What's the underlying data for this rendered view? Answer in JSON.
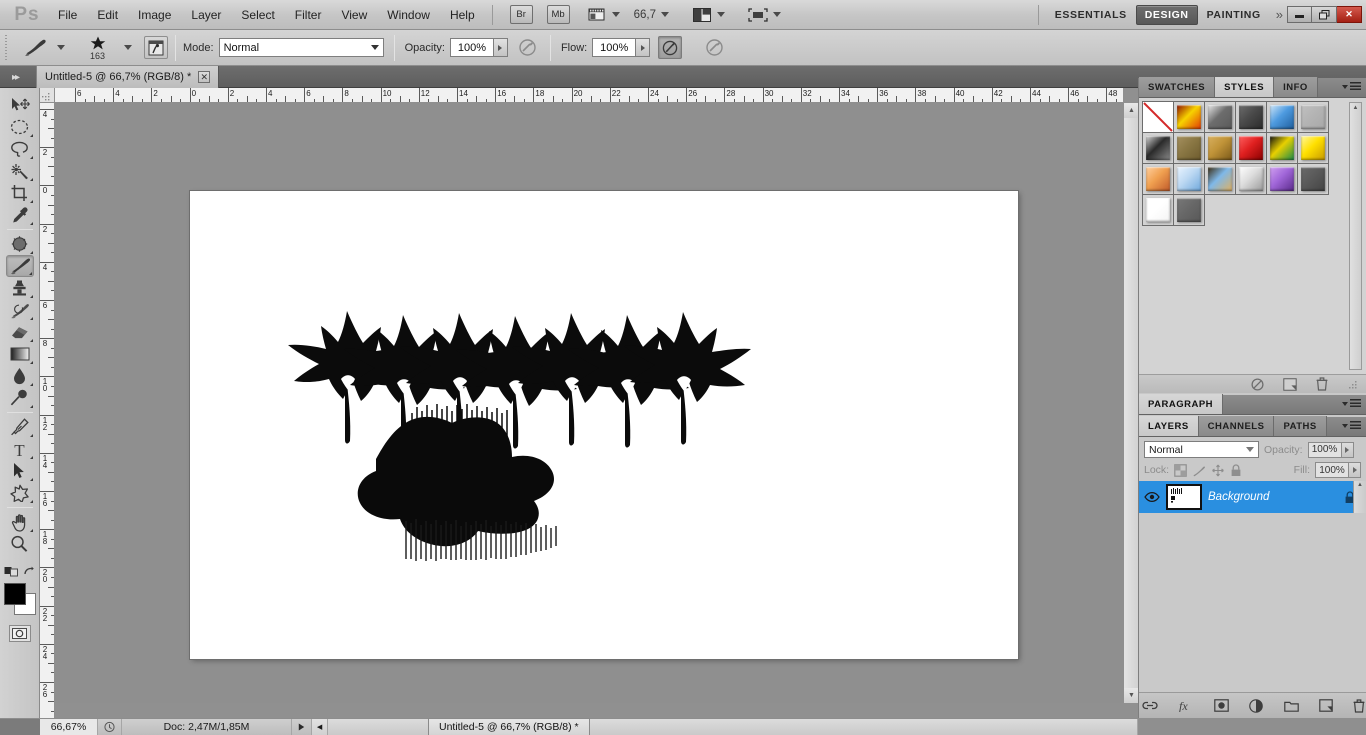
{
  "app": {
    "name": "Ps",
    "logo_label": "Ps"
  },
  "menubar": {
    "items": [
      "File",
      "Edit",
      "Image",
      "Layer",
      "Select",
      "Filter",
      "View",
      "Window",
      "Help"
    ],
    "bridge_label": "Br",
    "minibridge_label": "Mb",
    "zoom_value": "66,7",
    "screen_mode_icon": "screen-mode-icon",
    "arrange_icon": "arrange-documents-icon",
    "extras_icon": "view-extras-icon"
  },
  "workspaces": {
    "tabs": [
      "ESSENTIALS",
      "DESIGN",
      "PAINTING"
    ],
    "active": "DESIGN",
    "overflow_label": "»"
  },
  "window_controls": {
    "minimize": "–",
    "restore": "❐",
    "close": "✕"
  },
  "options_bar": {
    "brush_preset_icon": "brush-preset-icon",
    "brush_size": "163",
    "brush_panel_icon": "toggle-brush-panel-icon",
    "mode_label": "Mode:",
    "mode_value": "Normal",
    "opacity_label": "Opacity:",
    "opacity_value": "100%",
    "opacity_pressure_icon": "tablet-pressure-opacity-icon",
    "flow_label": "Flow:",
    "flow_value": "100%",
    "airbrush_icon": "airbrush-icon",
    "flow_pressure_icon": "tablet-pressure-size-icon"
  },
  "document_tab": {
    "title": "Untitled-5 @ 66,7% (RGB/8) *",
    "close_icon": "close-icon",
    "collapse_icon": "collapse-panel-icon"
  },
  "toolbox": {
    "tools": [
      {
        "name": "move-tool",
        "selected": false,
        "flyout": false
      },
      {
        "name": "elliptical-marquee-tool",
        "selected": false,
        "flyout": true
      },
      {
        "name": "lasso-tool",
        "selected": false,
        "flyout": true
      },
      {
        "name": "quick-selection-tool",
        "selected": false,
        "flyout": true
      },
      {
        "name": "crop-tool",
        "selected": false,
        "flyout": true
      },
      {
        "name": "eyedropper-tool",
        "selected": false,
        "flyout": true
      },
      {
        "name": "spot-healing-brush-tool",
        "selected": false,
        "flyout": true
      },
      {
        "name": "brush-tool",
        "selected": true,
        "flyout": true
      },
      {
        "name": "clone-stamp-tool",
        "selected": false,
        "flyout": true
      },
      {
        "name": "history-brush-tool",
        "selected": false,
        "flyout": true
      },
      {
        "name": "eraser-tool",
        "selected": false,
        "flyout": true
      },
      {
        "name": "gradient-tool",
        "selected": false,
        "flyout": true
      },
      {
        "name": "blur-tool",
        "selected": false,
        "flyout": true
      },
      {
        "name": "dodge-tool",
        "selected": false,
        "flyout": true
      },
      {
        "name": "pen-tool",
        "selected": false,
        "flyout": true
      },
      {
        "name": "horizontal-type-tool",
        "selected": false,
        "flyout": true
      },
      {
        "name": "path-selection-tool",
        "selected": false,
        "flyout": true
      },
      {
        "name": "custom-shape-tool",
        "selected": false,
        "flyout": true
      },
      {
        "name": "hand-tool",
        "selected": false,
        "flyout": true
      },
      {
        "name": "zoom-tool",
        "selected": false,
        "flyout": false
      }
    ],
    "foreground_color": "#000000",
    "background_color": "#ffffff",
    "quickmask_icon": "quick-mask-icon",
    "default-colors-icon": "default-colors-icon",
    "swap-colors-icon": "swap-colors-icon"
  },
  "rulers": {
    "unit": "cm",
    "horizontal_labels": [
      "6",
      "4",
      "2",
      "0",
      "2",
      "4",
      "6",
      "8",
      "10",
      "12",
      "14",
      "16",
      "18",
      "20",
      "22",
      "24",
      "26",
      "28",
      "30",
      "32",
      "34",
      "36",
      "38",
      "40",
      "42",
      "44",
      "46",
      "48"
    ],
    "vertical_labels": [
      "4",
      "2",
      "0",
      "2",
      "4",
      "6",
      "8",
      "10",
      "12",
      "14",
      "16",
      "18",
      "20",
      "22",
      "24",
      "26"
    ]
  },
  "canvas": {
    "background": "#ffffff",
    "artwork": [
      {
        "name": "maple-leaf-brush-stroke-row",
        "color": "#0a0a0a",
        "count": 7
      },
      {
        "name": "dense-leaf-scribble-blob",
        "color": "#0a0a0a"
      }
    ]
  },
  "panels": {
    "top_group": {
      "tabs": [
        "SWATCHES",
        "STYLES",
        "INFO"
      ],
      "active": "STYLES",
      "menu_icon": "panel-menu-icon",
      "styles": [
        {
          "name": "style-none",
          "kind": "none"
        },
        {
          "name": "style-sunset-sky",
          "c1": "#f7d200",
          "c2": "#e03a06",
          "c3": "#8e1100"
        },
        {
          "name": "style-bevel-gray",
          "c1": "#6d6d6d",
          "c2": "#5a5a5a",
          "c3": "#e8e8e8"
        },
        {
          "name": "style-dark-metal",
          "c1": "#4a4a4a",
          "c2": "#2b2b2b",
          "c3": "#6d6d6d"
        },
        {
          "name": "style-blue-glass",
          "c1": "#4e9be0",
          "c2": "#1f5f9e",
          "c3": "#cfe6f7"
        },
        {
          "name": "style-flat-gray",
          "c1": "#b4b4b4",
          "c2": "#a8a8a8",
          "c3": "#c0c0c0"
        },
        {
          "name": "style-gray-gradient",
          "c1": "#2a2a2a",
          "c2": "#8a8a8a",
          "c3": "#d8d8d8"
        },
        {
          "name": "style-olive-brown",
          "c1": "#8a7744",
          "c2": "#6e5c2e",
          "c3": "#a59060"
        },
        {
          "name": "style-golden-brown",
          "c1": "#c09338",
          "c2": "#7b5a1a",
          "c3": "#d8b060"
        },
        {
          "name": "style-red-stripes",
          "c1": "#e02020",
          "c2": "#8a0000",
          "c3": "#ff6060"
        },
        {
          "name": "style-rainbow-abstract",
          "c1": "#e8d000",
          "c2": "#1a8a4a",
          "c3": "#111111"
        },
        {
          "name": "style-yellow-glass",
          "c1": "#ffe000",
          "c2": "#c79a00",
          "c3": "#fff7a0"
        },
        {
          "name": "style-orange-sunset",
          "c1": "#f0a050",
          "c2": "#c05a2a",
          "c3": "#ffd0a0"
        },
        {
          "name": "style-light-blue-sky",
          "c1": "#bcd8f2",
          "c2": "#6fa8dc",
          "c3": "#eaf4ff"
        },
        {
          "name": "style-beach-horizon",
          "c1": "#7fb8e8",
          "c2": "#e0b060",
          "c3": "#3a2a10"
        },
        {
          "name": "style-noise-texture",
          "c1": "#dcdcdc",
          "c2": "#9a9a9a",
          "c3": "#ffffff"
        },
        {
          "name": "style-purple-shadow",
          "c1": "#a066d8",
          "c2": "#5a2a8a",
          "c3": "#d0a0f0"
        },
        {
          "name": "style-charcoal",
          "c1": "#5a5a5a",
          "c2": "#444444",
          "c3": "#6a6a6a"
        },
        {
          "name": "style-white-plain",
          "c1": "#ffffff",
          "c2": "#f4f4f4",
          "c3": "#ffffff"
        },
        {
          "name": "style-medium-gray",
          "c1": "#686868",
          "c2": "#585858",
          "c3": "#787878"
        }
      ],
      "footer_icons": [
        "clear-style-icon",
        "new-style-icon",
        "delete-style-icon",
        "resize-grip-icon"
      ]
    },
    "paragraph": {
      "tab": "PARAGRAPH",
      "menu_icon": "panel-menu-icon"
    },
    "layers_group": {
      "tabs": [
        "LAYERS",
        "CHANNELS",
        "PATHS"
      ],
      "active": "LAYERS",
      "menu_icon": "panel-menu-icon",
      "blend_mode": "Normal",
      "opacity_label": "Opacity:",
      "opacity_value": "100%",
      "lock_label": "Lock:",
      "lock_icons": [
        "lock-transparent-pixels-icon",
        "lock-image-pixels-icon",
        "lock-position-icon",
        "lock-all-icon"
      ],
      "fill_label": "Fill:",
      "fill_value": "100%",
      "layers": [
        {
          "name": "Background",
          "visible": true,
          "locked": true,
          "selected": true,
          "visibility_icon": "eye-icon",
          "lock_icon": "lock-icon"
        }
      ],
      "footer_icons": [
        "link-layers-icon",
        "layer-style-fx-icon",
        "add-layer-mask-icon",
        "new-adjustment-layer-icon",
        "new-group-icon",
        "new-layer-icon",
        "delete-layer-icon"
      ]
    }
  },
  "statusbar": {
    "zoom": "66,67%",
    "zoom_menu_icon": "zoom-menu-icon",
    "doc_info": "Doc: 2,47M/1,85M",
    "play_icon": "status-arrow-icon",
    "floating_tab": "Untitled-5 @ 66,7% (RGB/8) *"
  },
  "colors": {
    "accent_blue": "#2a8fe0",
    "chrome_light": "#d2d2d2",
    "chrome_mid": "#c2c2c2",
    "chrome_dark": "#6d6d6d",
    "canvas_bg": "#909090",
    "close_red": "#a41f13"
  }
}
